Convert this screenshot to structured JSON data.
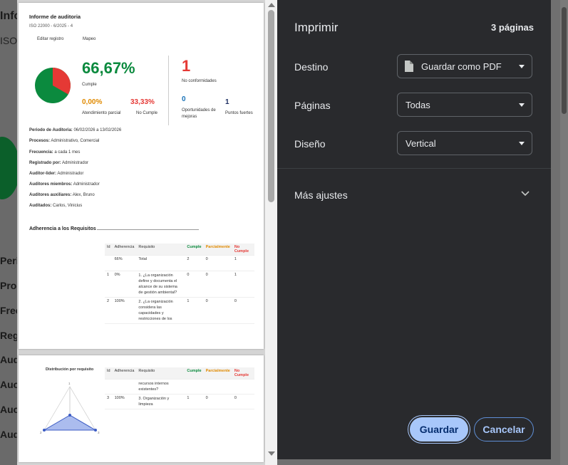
{
  "background": {
    "title_fragment": "Info",
    "subtitle_fragment": "ISO",
    "labels": [
      "Peri",
      "Proc",
      "Frec",
      "Reg",
      "Aud",
      "Auc",
      "Auc",
      "Aud"
    ]
  },
  "preview": {
    "page1": {
      "title": "Informe de auditoria",
      "subtitle": "ISO 22000 - 6/2025 - 4",
      "tabs": [
        "Editar registro",
        "Mapeo"
      ],
      "stats": {
        "percent": "66,67%",
        "percent_label": "Cumple",
        "partial_value": "0,00%",
        "partial_label": "Atendimiento parcial",
        "noncompliant_value": "33,33%",
        "noncompliant_label": "No Cumple",
        "nc_count": "1",
        "nc_label": "No conformidades",
        "opportunities_value": "0",
        "opportunities_label": "Oportunidades de mejoras",
        "strengths_value": "1",
        "strengths_label": "Puntos fuertes"
      },
      "details": [
        {
          "label": "Periodo de Auditoria:",
          "value": "06/02/2026 a 13/02/2026"
        },
        {
          "label": "Procesos:",
          "value": "Administrativo, Comercial"
        },
        {
          "label": "Frecuencia:",
          "value": "a cada 1 mes"
        },
        {
          "label": "Registrado por:",
          "value": "Administrador"
        },
        {
          "label": "Auditor-lider:",
          "value": "Administrador"
        },
        {
          "label": "Auditores miembros:",
          "value": "Administrador"
        },
        {
          "label": "Auditores auxiliares:",
          "value": "Alex, Bruno"
        },
        {
          "label": "Auditados:",
          "value": "Carlos, Vinicius"
        }
      ],
      "section_title": "Adherencia a los Requisitos",
      "table": {
        "headers": [
          "Id",
          "Adherencia",
          "Requisito",
          "Cumple",
          "Parcialmente",
          "No Cumple"
        ],
        "rows": [
          [
            "",
            "66%",
            "Total",
            "2",
            "0",
            "1"
          ],
          [
            "1",
            "0%",
            "1. ¿La organización define y documenta el alcance de su sistema de gestión ambiental?",
            "0",
            "0",
            "1"
          ],
          [
            "2",
            "100%",
            "2. ¿La organización considera las capacidades y restricciones de los",
            "1",
            "0",
            "0"
          ]
        ]
      }
    },
    "page2": {
      "chart_title": "Distribución por requisito",
      "radar_labels": [
        "1",
        "2",
        "3"
      ],
      "table": {
        "headers": [
          "Id",
          "Adherencia",
          "Requisito",
          "Cumple",
          "Parcialmente",
          "No Cumple"
        ],
        "continuation": "recursos internos existentes?",
        "rows": [
          [
            "3",
            "100%",
            "3. Organización y limpieza",
            "1",
            "0",
            "0"
          ]
        ]
      }
    }
  },
  "panel": {
    "title": "Imprimir",
    "pages_count": "3 páginas",
    "destination_label": "Destino",
    "destination_value": "Guardar como PDF",
    "pages_label": "Páginas",
    "pages_value": "Todas",
    "layout_label": "Diseño",
    "layout_value": "Vertical",
    "more_settings": "Más ajustes",
    "save_button": "Guardar",
    "cancel_button": "Cancelar"
  },
  "colors": {
    "panel_bg": "#292a2d",
    "accent": "#a8c7fa",
    "green": "#0b8a3e",
    "red": "#e53935",
    "orange": "#e08a00",
    "blue": "#1a73b8"
  }
}
